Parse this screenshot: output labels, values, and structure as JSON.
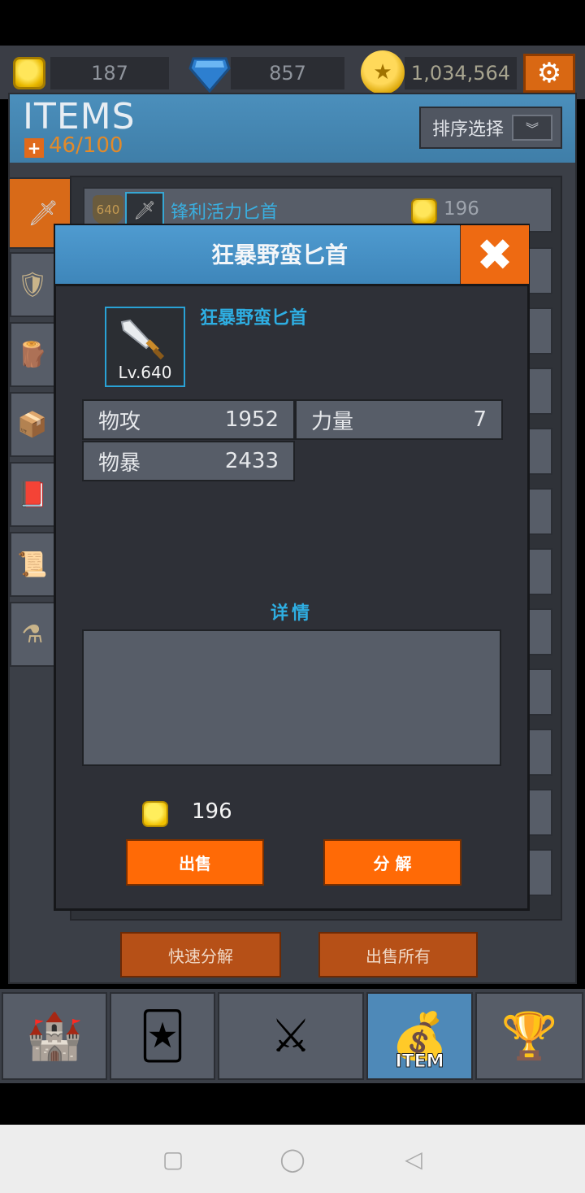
{
  "currency": {
    "coins": "187",
    "gems": "857",
    "gold": "1,034,564",
    "settings_icon": "gear-icon"
  },
  "items_header": {
    "title": "ITEMS",
    "capacity": "46/100",
    "sort_label": "排序选择"
  },
  "side_tabs": [
    "sword-icon",
    "shield-icon",
    "wood-log-icon",
    "chest-icon",
    "book-icon",
    "scroll-icon",
    "potion-icon"
  ],
  "list": {
    "first_row": {
      "level": "640",
      "name": "锋利活力匕首",
      "price": "196"
    }
  },
  "bottom_actions": {
    "quick_decompose": "快速分解",
    "sell_all": "出售所有"
  },
  "nav": {
    "tabs": [
      "castle-icon",
      "card-icon",
      "crossed-swords-icon",
      "item-bag-icon",
      "trophy-icon"
    ],
    "item_label": "ITEM",
    "active_index": 3
  },
  "modal": {
    "title": "狂暴野蛮匕首",
    "item_name": "狂暴野蛮匕首",
    "item_level": "Lv.640",
    "stats": [
      {
        "label": "物攻",
        "value": "1952"
      },
      {
        "label": "力量",
        "value": "7"
      },
      {
        "label": "物暴",
        "value": "2433"
      }
    ],
    "detail_label": "详情",
    "detail_text": "",
    "price": "196",
    "sell_label": "出售",
    "decompose_label": "分 解"
  },
  "colors": {
    "accent_orange": "#ff6a06",
    "accent_blue": "#3e86ba",
    "text_blue": "#2eaee2"
  }
}
